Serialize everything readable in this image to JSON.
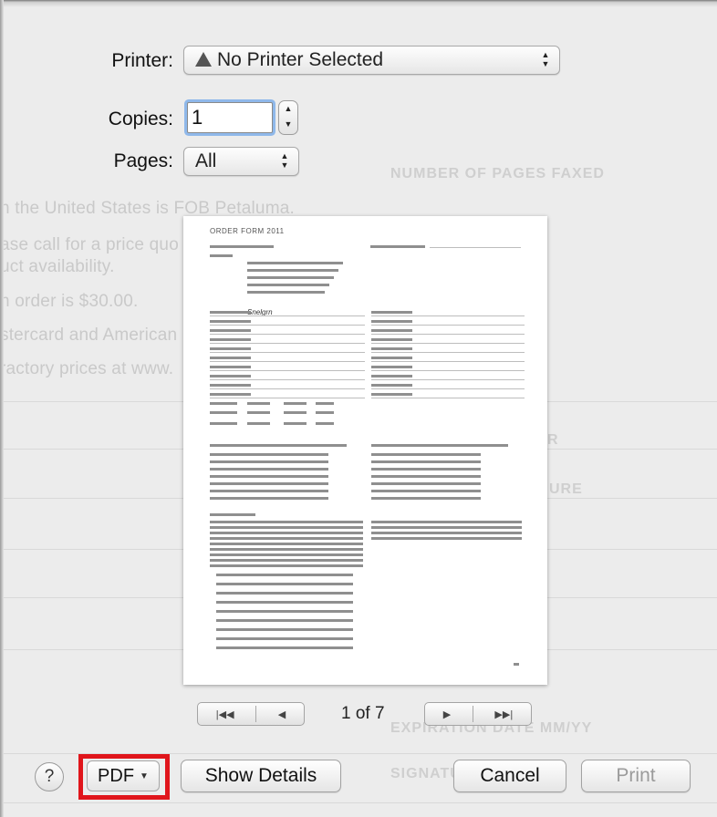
{
  "background": {
    "lines": [
      "n the United States is FOB Petaluma.",
      "ase call for a price quo",
      "uct availability.",
      "n order is $30.00.",
      "stercard and American",
      "ractory prices at www."
    ],
    "right_headings": [
      "NUMBER OF PAGES FAXED",
      "EXPIRATION DATE MM/YY",
      "SIGNATU"
    ],
    "faint_fragments": [
      "R",
      "URE"
    ]
  },
  "print_dialog": {
    "printer": {
      "label": "Printer:",
      "value": "No Printer Selected",
      "icon": "warning-triangle-icon"
    },
    "copies": {
      "label": "Copies:",
      "value": "1"
    },
    "pages": {
      "label": "Pages:",
      "value": "All"
    },
    "preview": {
      "document_title": "ORDER FORM 2011",
      "handwritten": "Snelgrn",
      "current_page": 1,
      "total_pages": 7,
      "page_indicator": "1 of 7"
    },
    "footer": {
      "help_label": "?",
      "pdf_label": "PDF",
      "show_details_label": "Show Details",
      "cancel_label": "Cancel",
      "print_label": "Print"
    },
    "highlight_color": "#e0151b"
  }
}
